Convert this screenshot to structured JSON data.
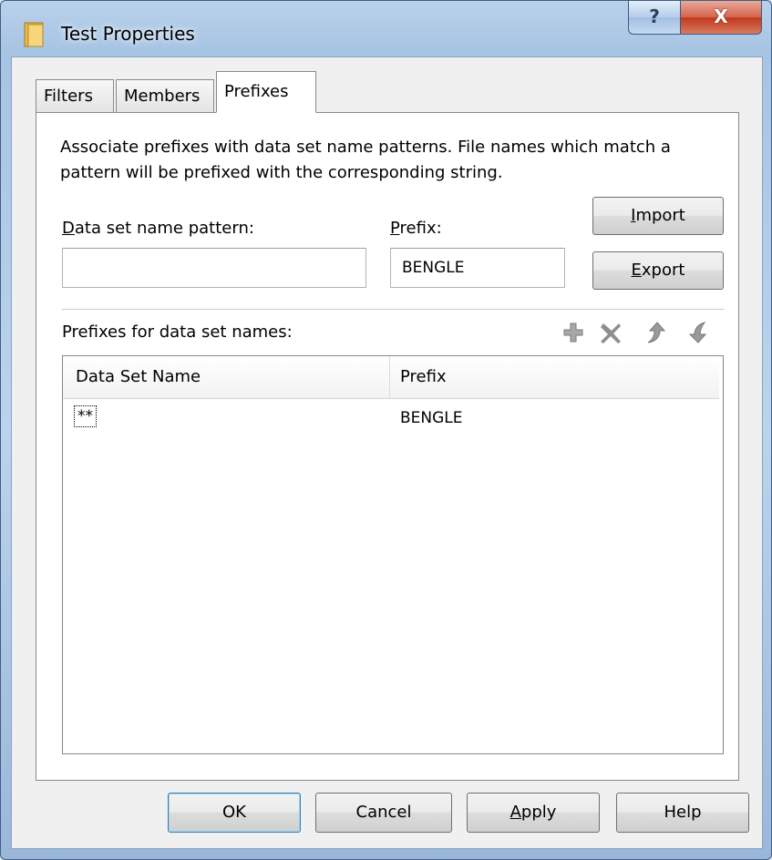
{
  "window": {
    "title": "Test Properties",
    "help_caption": "?",
    "close_caption": "X"
  },
  "tabs": [
    {
      "label": "Filters",
      "active": false
    },
    {
      "label": "Members",
      "active": false
    },
    {
      "label": "Prefixes",
      "active": true
    }
  ],
  "prefixes": {
    "description": "Associate prefixes with data set name patterns.  File names which match a pattern will be prefixed with the corresponding string.",
    "pattern_label_accel": "D",
    "pattern_label_rest": "ata set name pattern:",
    "pattern_value": "",
    "prefix_label_accel": "P",
    "prefix_label_rest": "refix:",
    "prefix_value": "BENGLE",
    "import_accel": "I",
    "import_rest": "mport",
    "export_accel": "E",
    "export_rest": "xport",
    "list_label": "Prefixes for data set names:",
    "toolbar_icons": [
      "add-icon",
      "delete-icon",
      "move-up-icon",
      "move-down-icon"
    ],
    "columns": [
      "Data Set Name",
      "Prefix"
    ],
    "rows": [
      {
        "data_set_name": "**",
        "prefix": "BENGLE"
      }
    ]
  },
  "buttons": {
    "ok": "OK",
    "cancel": "Cancel",
    "apply_accel": "A",
    "apply_rest": "pply",
    "help": "Help"
  },
  "colors": {
    "title_bar": "#b9d1ea",
    "close_button": "#c2381b",
    "default_button_border": "#3c7fb1"
  }
}
